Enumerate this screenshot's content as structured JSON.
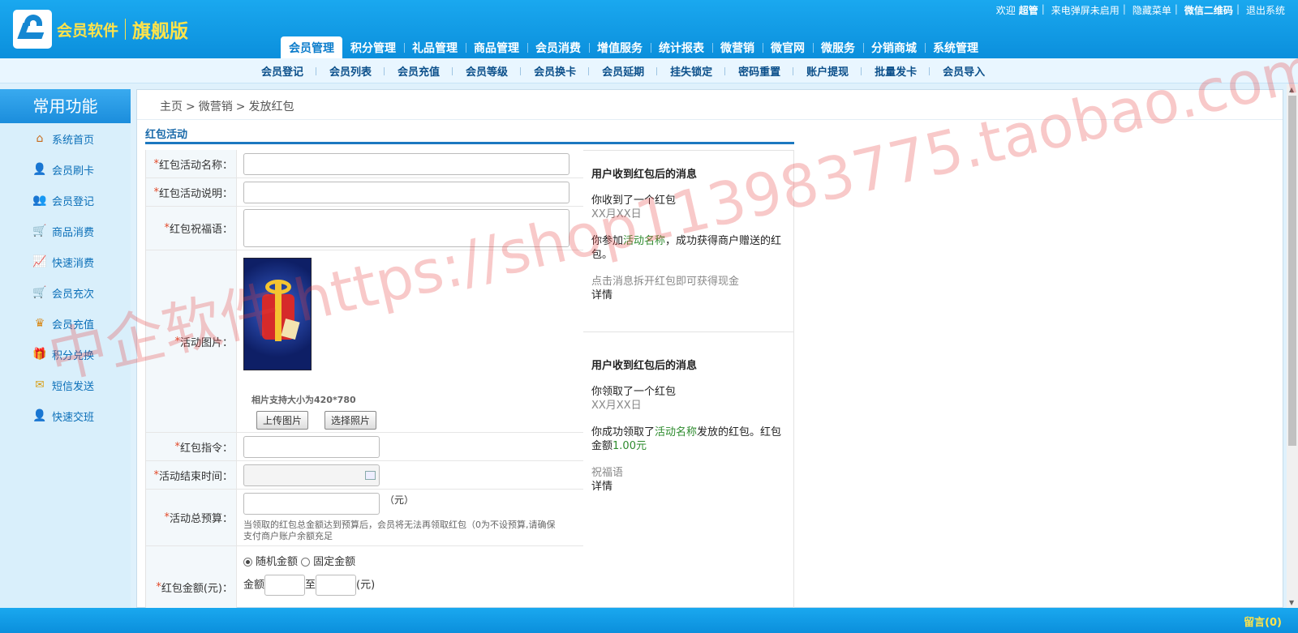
{
  "logo": {
    "name": "会员软件",
    "edition": "旗舰版"
  },
  "top_links": {
    "welcome": "欢迎",
    "user": "超管",
    "popup": "来电弹屏未启用",
    "hide_menu": "隐藏菜单",
    "wechat_qr": "微信二维码",
    "logout": "退出系统"
  },
  "main_nav": [
    "会员管理",
    "积分管理",
    "礼品管理",
    "商品管理",
    "会员消费",
    "增值服务",
    "统计报表",
    "微营销",
    "微官网",
    "微服务",
    "分销商城",
    "系统管理"
  ],
  "sub_nav": [
    "会员登记",
    "会员列表",
    "会员充值",
    "会员等级",
    "会员换卡",
    "会员延期",
    "挂失锁定",
    "密码重置",
    "账户提现",
    "批量发卡",
    "会员导入"
  ],
  "sidebar": {
    "title": "常用功能",
    "items": [
      {
        "label": "系统首页",
        "icon": "home-icon"
      },
      {
        "label": "会员刷卡",
        "icon": "member-card-icon"
      },
      {
        "label": "会员登记",
        "icon": "user-add-icon"
      },
      {
        "label": "商品消费",
        "icon": "cart-icon"
      },
      {
        "label": "快速消费",
        "icon": "chart-icon"
      },
      {
        "label": "会员充次",
        "icon": "cart-count-icon"
      },
      {
        "label": "会员充值",
        "icon": "crown-icon"
      },
      {
        "label": "积分兑换",
        "icon": "gift-icon"
      },
      {
        "label": "短信发送",
        "icon": "mail-icon"
      },
      {
        "label": "快速交班",
        "icon": "handover-icon"
      }
    ]
  },
  "breadcrumb": [
    "主页",
    "微营销",
    "发放红包"
  ],
  "section_title": "红包活动",
  "form": {
    "name_label": "红包活动名称：",
    "desc_label": "红包活动说明：",
    "wish_label": "红包祝福语：",
    "image_label": "活动图片：",
    "image_hint": "相片支持大小为420*780",
    "upload_btn": "上传图片",
    "choose_btn": "选择照片",
    "command_label": "红包指令：",
    "end_time_label": "活动结束时间：",
    "budget_label": "活动总预算：",
    "budget_unit": "（元）",
    "budget_note_1": "当领取的红包总金额达到预算后，会员将无法再领取红包（0为不设预算,请确保",
    "budget_note_2": "支付商户账户余额充足",
    "amount_label": "红包金额(元)：",
    "random_amount": "随机金额",
    "fixed_amount": "固定金额",
    "amount_prefix": "金额",
    "amount_to": "至",
    "amount_unit": "(元)"
  },
  "preview": {
    "a_title": "用户收到红包后的消息",
    "a_line1": "你收到了一个红包",
    "a_date": "XX月XX日",
    "a_p_1": "你参加",
    "a_p_name": "活动名称",
    "a_p_2": "，成功获得商户赠送的红包。",
    "a_open": "点击消息拆开红包即可获得现金",
    "a_detail": "详情",
    "b_title": "用户收到红包后的消息",
    "b_line1": "你领取了一个红包",
    "b_date": "XX月XX日",
    "b_p_1": "你成功领取了",
    "b_p_name": "活动名称",
    "b_p_2": "发放的红包。红包金额",
    "b_p_amount": "1.00元",
    "b_wish": "祝福语",
    "b_detail": "详情"
  },
  "footer": {
    "message": "留言(0)"
  },
  "watermark": "中企软件 https://shop113983775.taobao.com"
}
